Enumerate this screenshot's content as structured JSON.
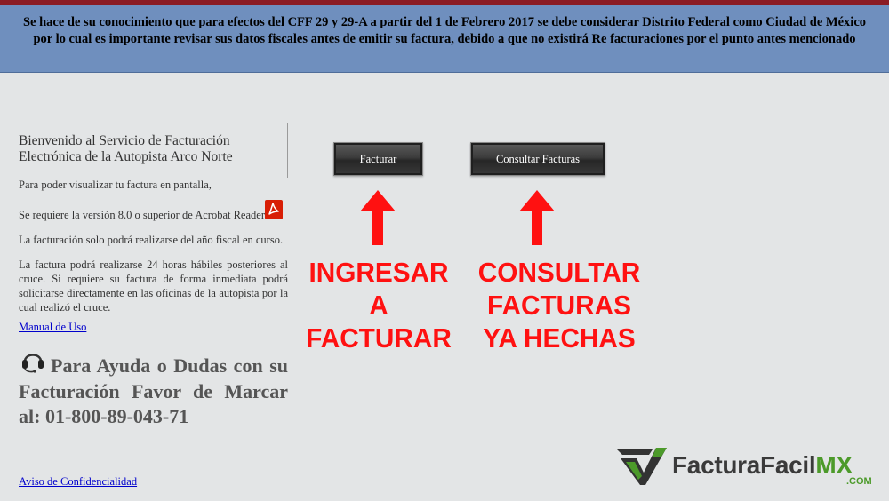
{
  "notice": {
    "line1": "Se hace de su conocimiento que para efectos del CFF 29 y 29-A a partir del 1 de Febrero 2017 se debe considerar Distrito Federal como Ciudad de México",
    "line2": "por lo cual es importante revisar sus datos fiscales antes de emitir su factura, debido a que no existirá Re facturaciones por el punto antes mencionado"
  },
  "sidebar": {
    "welcome_line1": "Bienvenido al Servicio de Facturación",
    "welcome_line2": "Electrónica de la Autopista Arco Norte",
    "view_info": "Para poder visualizar tu factura en pantalla,",
    "acrobat_req": "Se requiere la versión 8.0 o superior de Acrobat Reader",
    "fiscal_year": "La facturación solo podrá realizarse del año fiscal en curso.",
    "hours_info": "La factura podrá realizarse 24 horas hábiles posteriores al cruce. Si requiere su factura de forma inmediata podrá solicitarse directamente en las oficinas de la autopista por la cual realizó el cruce.",
    "manual_link": "Manual de Uso",
    "help_text": "Para Ayuda o Dudas con su Facturación Favor de Marcar al: 01-800-89-043-71",
    "privacy_link": "Aviso de Confidencialidad"
  },
  "buttons": {
    "facturar": "Facturar",
    "consultar": "Consultar Facturas"
  },
  "annotations": {
    "left": [
      "INGRESAR",
      "A",
      "FACTURAR"
    ],
    "right": [
      "CONSULTAR",
      "FACTURAS",
      "YA HECHAS"
    ]
  },
  "logo": {
    "main": "FacturaFacil",
    "suffix": "MX",
    "domain": ".COM"
  },
  "colors": {
    "banner": "#6f8fbe",
    "top_stripe": "#8b1c24",
    "annotation_red": "#ff1111",
    "logo_green": "#4c9a2a"
  }
}
